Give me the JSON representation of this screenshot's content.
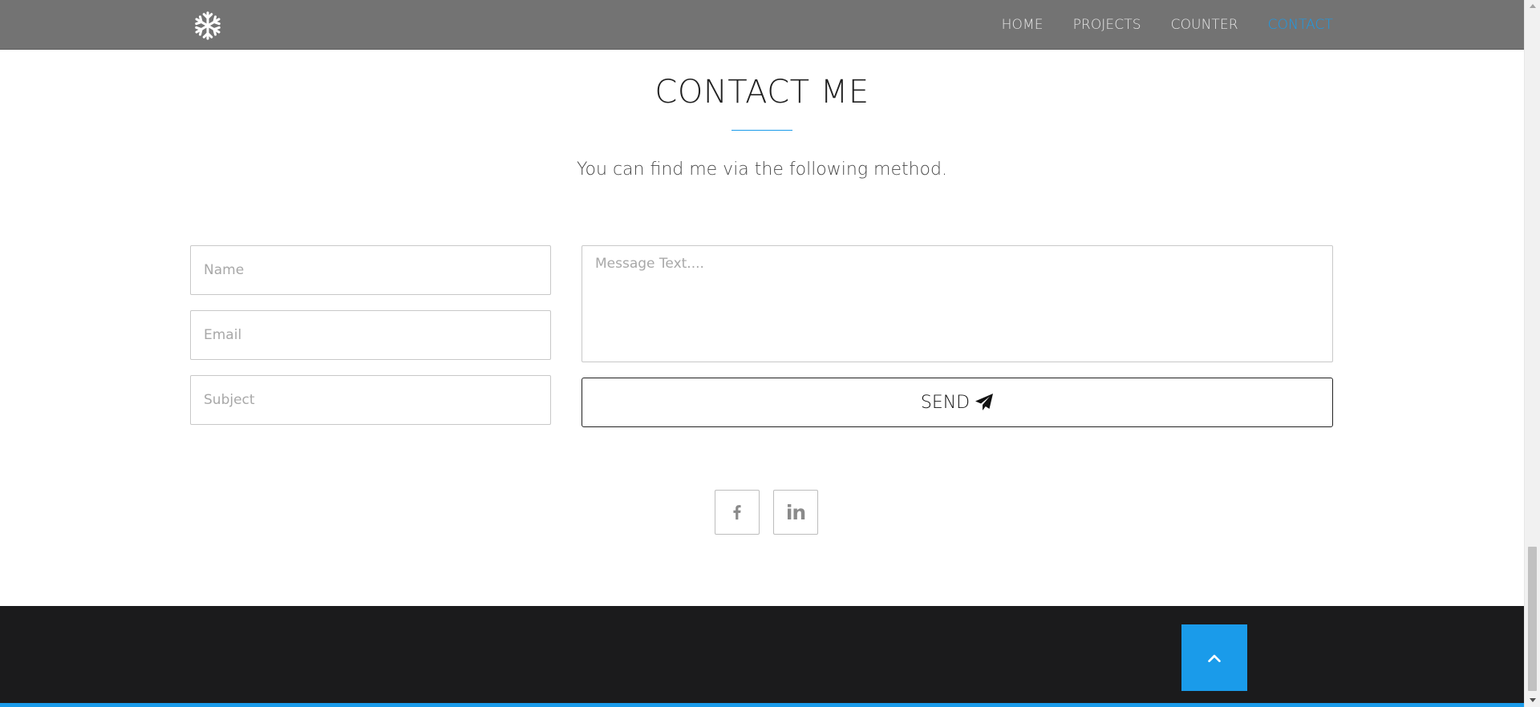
{
  "navbar": {
    "logo_icon": "snowflake-icon",
    "items": [
      {
        "label": "HOME",
        "active": false
      },
      {
        "label": "PROJECTS",
        "active": false
      },
      {
        "label": "COUNTER",
        "active": false
      },
      {
        "label": "CONTACT",
        "active": true
      }
    ]
  },
  "contact": {
    "title": "CONTACT ME",
    "subtitle": "You can find me via the following method.",
    "form": {
      "name_placeholder": "Name",
      "email_placeholder": "Email",
      "subject_placeholder": "Subject",
      "message_placeholder": "Message Text....",
      "send_label": "SEND",
      "send_icon": "paper-plane-icon"
    },
    "social": [
      {
        "name": "facebook",
        "icon": "facebook-icon",
        "glyph": "f"
      },
      {
        "name": "linkedin",
        "icon": "linkedin-icon",
        "glyph": "in"
      }
    ]
  },
  "footer": {
    "back_to_top_icon": "chevron-up-icon"
  },
  "colors": {
    "accent": "#1a9bea",
    "navbar": "#737373",
    "footer": "#1b1b1c",
    "text": "#222222"
  }
}
